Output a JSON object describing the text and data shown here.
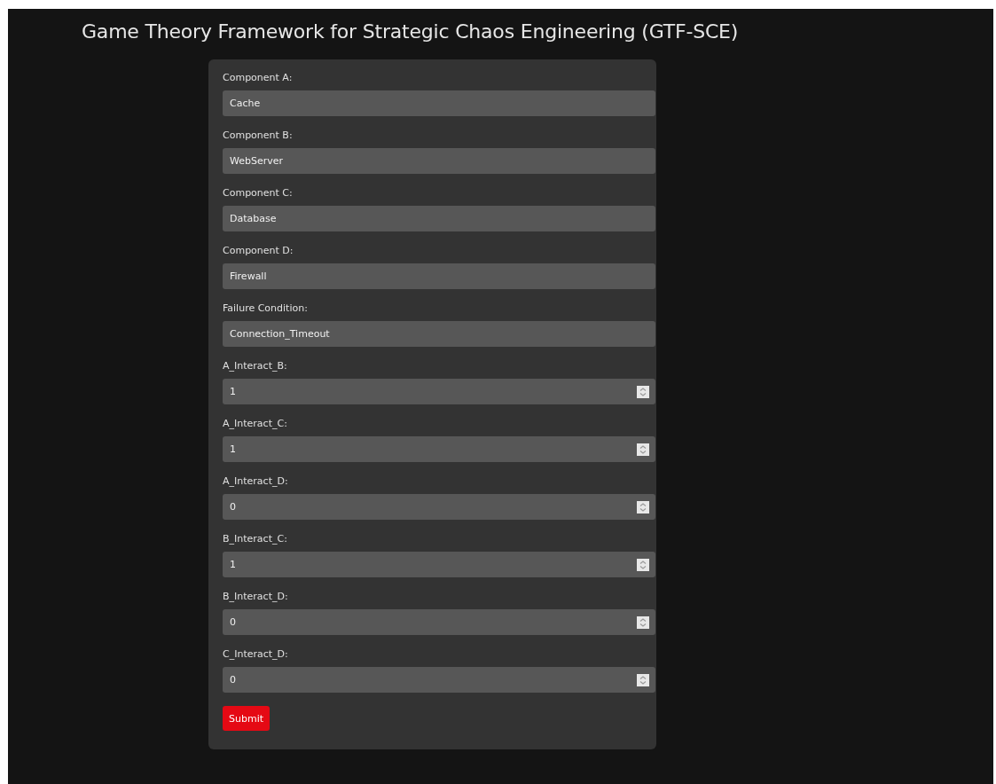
{
  "title": "Game Theory Framework for Strategic Chaos Engineering (GTF-SCE)",
  "fields": [
    {
      "label": "Component A:",
      "value": "Cache",
      "kind": "text"
    },
    {
      "label": "Component B:",
      "value": "WebServer",
      "kind": "text"
    },
    {
      "label": "Component C:",
      "value": "Database",
      "kind": "text"
    },
    {
      "label": "Component D:",
      "value": "Firewall",
      "kind": "text"
    },
    {
      "label": "Failure Condition:",
      "value": "Connection_Timeout",
      "kind": "text"
    },
    {
      "label": "A_Interact_B:",
      "value": "1",
      "kind": "number"
    },
    {
      "label": "A_Interact_C:",
      "value": "1",
      "kind": "number"
    },
    {
      "label": "A_Interact_D:",
      "value": "0",
      "kind": "number"
    },
    {
      "label": "B_Interact_C:",
      "value": "1",
      "kind": "number"
    },
    {
      "label": "B_Interact_D:",
      "value": "0",
      "kind": "number"
    },
    {
      "label": "C_Interact_D:",
      "value": "0",
      "kind": "number"
    }
  ],
  "submit": "Submit"
}
